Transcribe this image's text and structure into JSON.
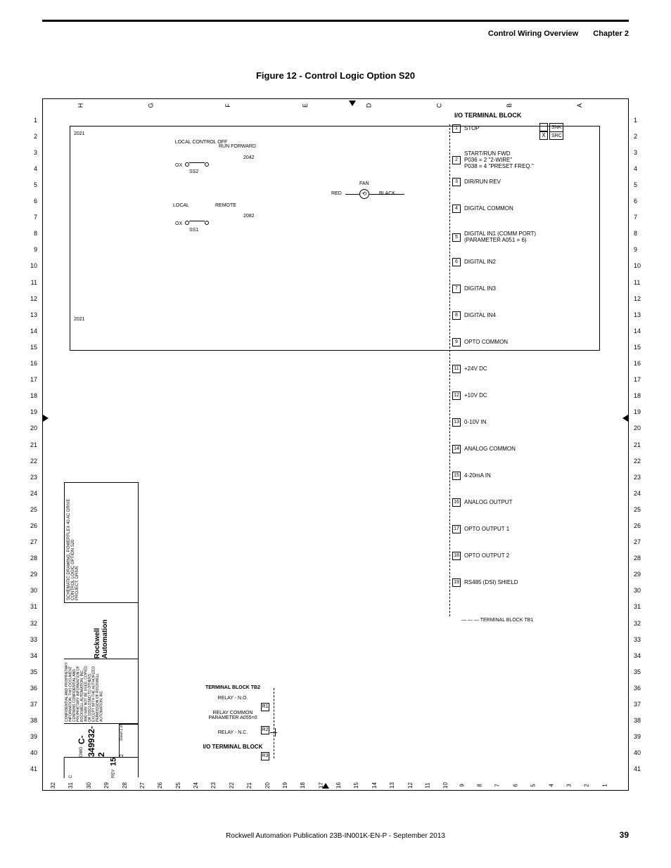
{
  "header": {
    "section": "Control Wiring Overview",
    "chapter": "Chapter 2"
  },
  "figure_title": "Figure 12 - Control Logic Option S20",
  "title_block": {
    "schematic_line1": "SCHEMATIC DRAWING, POWERFLEX 40 AC DRIVE",
    "schematic_line2": "CONTROL LOGIC OPTION S20",
    "schematic_line3": "PROJECT: DRIVE",
    "logo": "Rockwell Automation",
    "legal": "CONFIDENTIAL AND PROPRIETARY INFORMATION. THIS DOCUMENT CONTAINS CONFIDENTIAL AND PROPRIETARY INFORMATION OF ROCKWELL AUTOMATION, INC., AND MAY NOT BE USED, COPIED OR DISCLOSED TO OTHERS, EXCEPT WITH THE AUTHORIZED PERMISSION OF ROCKWELL AUTOMATION, INC.",
    "dwg_prefix": "DWG",
    "dwg_no": "C-349932-2",
    "sheet": "Sheet 1 of",
    "sheet_count": "2",
    "rev_label": "REV",
    "rev": "15",
    "size": "C"
  },
  "columns": [
    "H",
    "G",
    "F",
    "E",
    "D",
    "C",
    "B",
    "A"
  ],
  "schematic": {
    "ref_left": "2021",
    "ref_left2": "2021",
    "local_control_off": "LOCAL CONTROL OFF",
    "run_forward": "RUN FORWARD",
    "ox1": "OX",
    "ss2": "SS2",
    "wire1": "2042",
    "local": "LOCAL",
    "remote": "REMOTE",
    "ox2": "OX",
    "ss1": "SS1",
    "wire2": "2082",
    "fan": "FAN",
    "red": "RED",
    "black": "BLACK"
  },
  "io_block": {
    "title": "I/O TERMINAL BLOCK",
    "snk": "SNK",
    "src": "SRC",
    "terminals": [
      {
        "n": "1",
        "label": "STOP"
      },
      {
        "n": "2",
        "label": "START/RUN FWD\nP036 = 2 \"2-WIRE\"\nP038 = 4 \"PRESET FREQ.\""
      },
      {
        "n": "3",
        "label": "DIR/RUN REV"
      },
      {
        "n": "4",
        "label": "DIGITAL COMMON"
      },
      {
        "n": "5",
        "label": "DIGITAL IN1 (COMM PORT)\n(PARAMETER A051 = 6)"
      },
      {
        "n": "6",
        "label": "DIGITAL IN2"
      },
      {
        "n": "7",
        "label": "DIGITAL IN3"
      },
      {
        "n": "8",
        "label": "DIGITAL IN4"
      },
      {
        "n": "9",
        "label": "OPTO COMMON"
      },
      {
        "n": "11",
        "label": "+24V DC"
      },
      {
        "n": "12",
        "label": "+10V DC"
      },
      {
        "n": "13",
        "label": "0-10V IN"
      },
      {
        "n": "14",
        "label": "ANALOG COMMON"
      },
      {
        "n": "15",
        "label": "4-20mA IN"
      },
      {
        "n": "16",
        "label": "ANALOG OUTPUT"
      },
      {
        "n": "17",
        "label": "OPTO OUTPUT 1"
      },
      {
        "n": "18",
        "label": "OPTO OUTPUT 2"
      },
      {
        "n": "19",
        "label": "RS485 (DSI) SHIELD"
      }
    ],
    "tb1_label": "TERMINAL BLOCK TB1"
  },
  "tb2": {
    "title": "TERMINAL BLOCK TB2",
    "relay_no": "RELAY - N.O.",
    "relay_common": "RELAY COMMON\nPARAMETER A055=0",
    "relay_nc": "RELAY - N.C.",
    "io_title": "I/O TERMINAL BLOCK",
    "r1": "R1",
    "r2": "R2",
    "r3": "R3"
  },
  "footer": {
    "pub": "Rockwell Automation Publication 23B-IN001K-EN-P - September 2013",
    "page": "39"
  }
}
